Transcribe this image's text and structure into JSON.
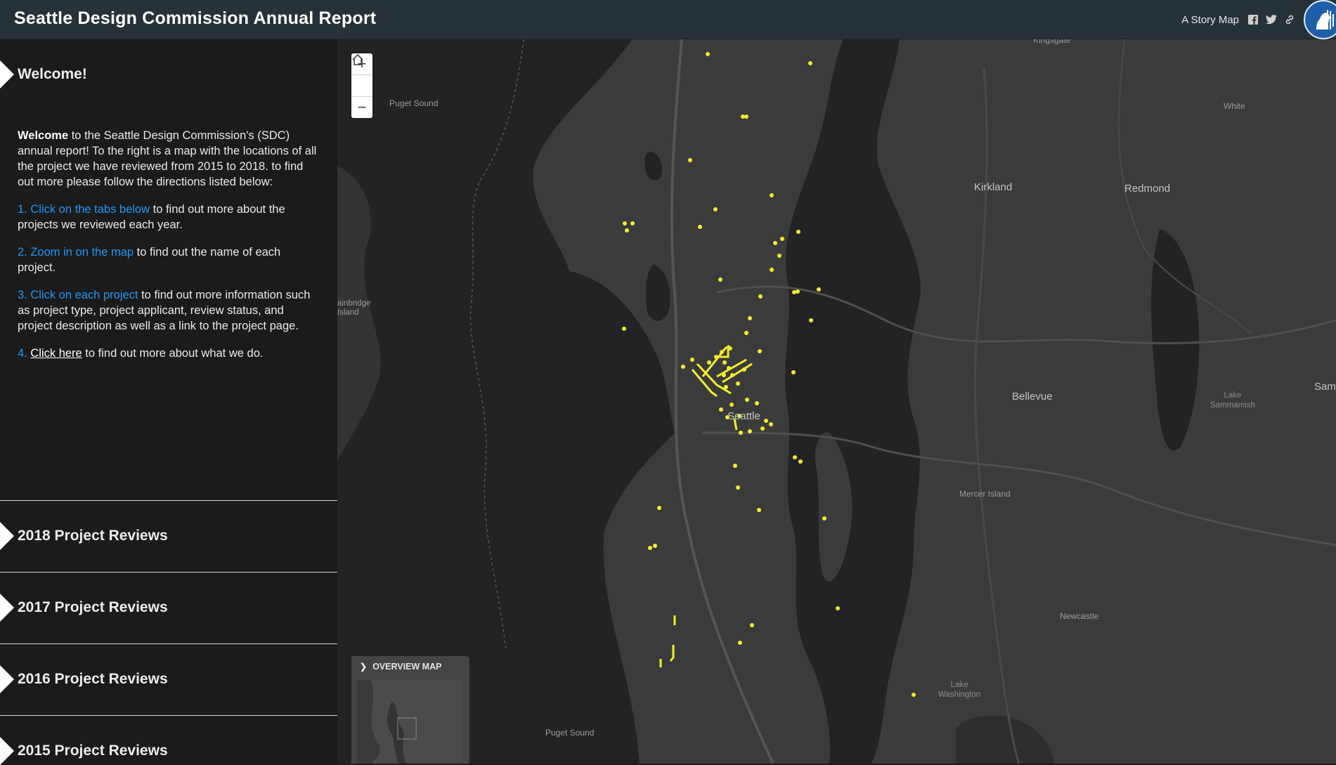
{
  "header": {
    "title": "Seattle Design Commission Annual Report",
    "story_map_label": "A Story Map"
  },
  "sidebar": {
    "welcome": {
      "heading": "Welcome!",
      "intro_bold": "Welcome",
      "intro_text": " to the Seattle Design Commission's (SDC) annual report! To the right is a map with the locations of all the project we have reviewed from 2015 to 2018. to find out more please follow the directions listed below:",
      "step1_link": "1. Click on the tabs below",
      "step1_text": " to find out more about the projects we reviewed each year.",
      "step2_link": "2. Zoom in on the map",
      "step2_text": " to find out the name of each project.",
      "step3_link": "3. Click on each project",
      "step3_text": " to find out more information such as project type, project applicant, review status, and project description as well as a link to the project page.",
      "step4_num": "4.",
      "step4_link": "Click here",
      "step4_text": " to find out more about what we do."
    },
    "tabs": [
      {
        "label": "2018 Project Reviews"
      },
      {
        "label": "2017 Project Reviews"
      },
      {
        "label": "2016 Project Reviews"
      },
      {
        "label": "2015 Project Reviews"
      }
    ]
  },
  "map": {
    "zoom_in": "+",
    "zoom_out": "−",
    "labels": {
      "kingsgate": "Kingsgate",
      "puget_sound_n": "Puget Sound",
      "white": "White",
      "kirkland": "Kirkland",
      "redmond": "Redmond",
      "bainbridge": "ainbridge\nIsland",
      "bellevue": "Bellevue",
      "lake_sammamish": "Lake\nSammamish",
      "sam": "Sam",
      "seattle": "Seattle",
      "mercer_island": "Mercer Island",
      "newcastle": "Newcastle",
      "lake_washington": "Lake\nWashington",
      "puget_sound_s": "Puget Sound"
    },
    "overview_label": "OVERVIEW MAP",
    "colors": {
      "land": "#3b3b3b",
      "water": "#232326",
      "project_point": "#f5ee2f"
    }
  }
}
